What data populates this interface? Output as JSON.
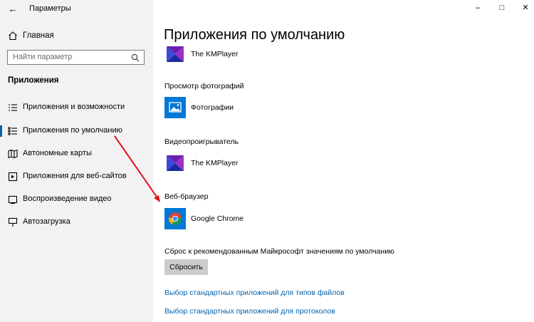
{
  "window": {
    "title": "Параметры",
    "back_icon": "back-arrow-icon",
    "controls": [
      "minimize-icon",
      "maximize-icon",
      "close-icon"
    ]
  },
  "sidebar": {
    "home_label": "Главная",
    "search_placeholder": "Найти параметр",
    "section_title": "Приложения",
    "items": [
      {
        "label": "Приложения и возможности",
        "icon": "apps-features-icon",
        "active": false
      },
      {
        "label": "Приложения по умолчанию",
        "icon": "default-apps-icon",
        "active": true
      },
      {
        "label": "Автономные карты",
        "icon": "offline-maps-icon",
        "active": false
      },
      {
        "label": "Приложения для веб-сайтов",
        "icon": "apps-for-websites-icon",
        "active": false
      },
      {
        "label": "Воспроизведение видео",
        "icon": "video-playback-icon",
        "active": false
      },
      {
        "label": "Автозагрузка",
        "icon": "startup-icon",
        "active": false
      }
    ]
  },
  "main": {
    "title": "Приложения по умолчанию",
    "top_app": {
      "name": "The KMPlayer",
      "icon": "kmplayer-icon"
    },
    "categories": [
      {
        "label": "Просмотр фотографий",
        "app": "Фотографии",
        "icon": "photos-icon"
      },
      {
        "label": "Видеопроигрыватель",
        "app": "The KMPlayer",
        "icon": "kmplayer-icon"
      },
      {
        "label": "Веб-браузер",
        "app": "Google Chrome",
        "icon": "chrome-icon"
      }
    ],
    "reset_text": "Сброс к рекомендованным Майкрософт значениям по умолчанию",
    "reset_button": "Сбросить",
    "links": [
      "Выбор стандартных приложений для типов файлов",
      "Выбор стандартных приложений для протоколов"
    ]
  },
  "colors": {
    "accent": "#0063b1",
    "annotation_arrow": "#e0141c",
    "tile_blue": "#0078d7"
  }
}
